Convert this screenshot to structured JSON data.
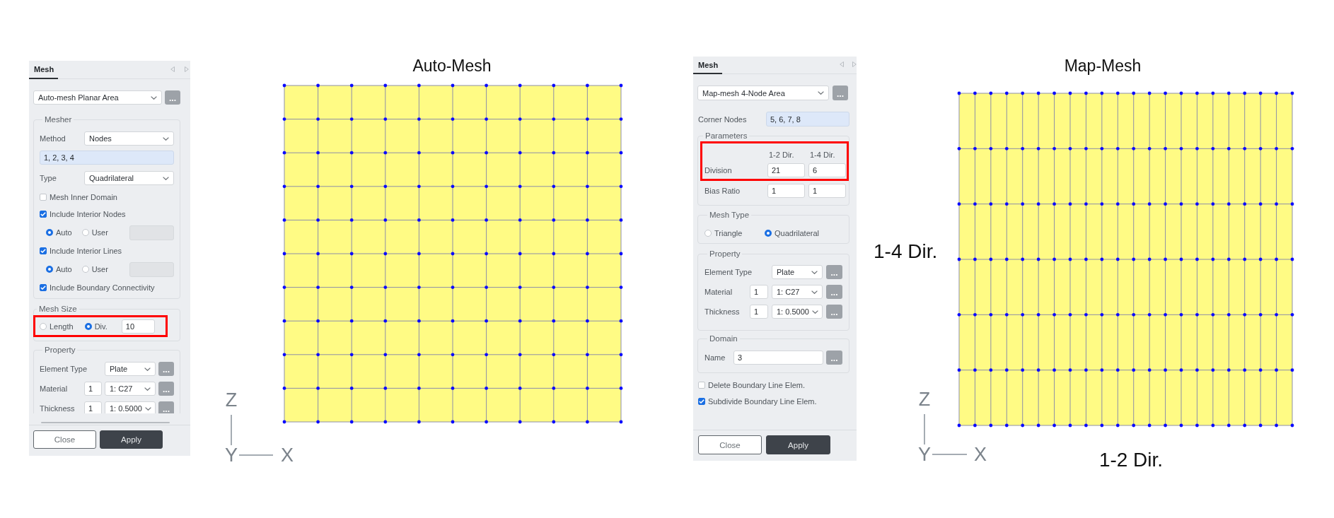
{
  "auto_mesh": {
    "panel": {
      "tabs": [
        {
          "label": "Mesh",
          "selected": true
        }
      ],
      "mesh_mode": {
        "value": "Auto-mesh Planar Area",
        "button": "..."
      },
      "mesher": {
        "legend": "Mesher",
        "method": {
          "label": "Method",
          "value": "Nodes"
        },
        "nodes": {
          "value": "1, 2, 3, 4"
        },
        "type": {
          "label": "Type",
          "value": "Quadrilateral"
        },
        "options": [
          {
            "kind": "checkbox",
            "label": "Mesh Inner Domain",
            "checked": false
          },
          {
            "kind": "checkbox",
            "label": "Include Interior Nodes",
            "checked": true
          },
          {
            "kind": "choice",
            "options": [
              {
                "label": "Auto",
                "selected": true
              },
              {
                "label": "User",
                "selected": false
              }
            ],
            "field": {
              "disabled": true
            }
          },
          {
            "kind": "checkbox",
            "label": "Include Interior Lines",
            "checked": true
          },
          {
            "kind": "choice",
            "options": [
              {
                "label": "Auto",
                "selected": true
              },
              {
                "label": "User",
                "selected": false
              }
            ],
            "field": {
              "disabled": true
            }
          },
          {
            "kind": "checkbox",
            "label": "Include Boundary Connectivity",
            "checked": true
          }
        ]
      },
      "mesh_size": {
        "legend": "Mesh Size",
        "highlighted": true,
        "choices": [
          {
            "label": "Length",
            "selected": false
          },
          {
            "label": "Div.",
            "selected": true
          }
        ],
        "value": "10"
      },
      "property": {
        "legend": "Property",
        "rows": [
          {
            "kind": "select",
            "label": "Element Type",
            "value": "Plate",
            "button": "..."
          },
          {
            "kind": "indexed",
            "label": "Material",
            "number": "1",
            "value": "1: C27",
            "button": "..."
          },
          {
            "kind": "indexed",
            "label": "Thickness",
            "number": "1",
            "value": "1: 0.5000",
            "button": "..."
          }
        ]
      },
      "buttons": [
        {
          "label": "Close",
          "kind": "secondary"
        },
        {
          "label": "Apply",
          "kind": "primary"
        }
      ]
    },
    "viewport": {
      "title": "Auto-Mesh",
      "axes": {
        "vertical": "Z",
        "horizontal": "X",
        "depth": "Y"
      }
    }
  },
  "map_mesh": {
    "panel": {
      "tabs": [
        {
          "label": "Mesh",
          "selected": true
        }
      ],
      "mesh_mode": {
        "value": "Map-mesh 4-Node Area",
        "button": "..."
      },
      "corner_nodes": {
        "label": "Corner Nodes",
        "value": "5, 6, 7, 8"
      },
      "parameters": {
        "legend": "Parameters",
        "highlighted": true,
        "columns": [
          "1-2 Dir.",
          "1-4 Dir."
        ],
        "rows": [
          {
            "label": "Division",
            "values": [
              "21",
              "6"
            ]
          },
          {
            "label": "Bias Ratio",
            "values": [
              "1",
              "1"
            ]
          }
        ]
      },
      "mesh_type": {
        "legend": "Mesh Type",
        "choices": [
          {
            "label": "Triangle",
            "selected": false
          },
          {
            "label": "Quadrilateral",
            "selected": true
          }
        ]
      },
      "property": {
        "legend": "Property",
        "rows": [
          {
            "kind": "select",
            "label": "Element Type",
            "value": "Plate",
            "button": "..."
          },
          {
            "kind": "indexed",
            "label": "Material",
            "number": "1",
            "value": "1: C27",
            "button": "..."
          },
          {
            "kind": "indexed",
            "label": "Thickness",
            "number": "1",
            "value": "1: 0.5000",
            "button": "..."
          }
        ]
      },
      "domain": {
        "legend": "Domain",
        "label": "Name",
        "value": "3",
        "button": "..."
      },
      "options": [
        {
          "label": "Delete Boundary Line Elem.",
          "checked": false
        },
        {
          "label": "Subdivide Boundary Line Elem.",
          "checked": true
        }
      ],
      "buttons": [
        {
          "label": "Close",
          "kind": "secondary"
        },
        {
          "label": "Apply",
          "kind": "primary"
        }
      ]
    },
    "viewport": {
      "title": "Map-Mesh",
      "axes": {
        "vertical": "Z",
        "horizontal": "X",
        "depth": "Y"
      },
      "direction_labels": {
        "vertical": "1-4 Dir.",
        "horizontal": "1-2 Dir."
      }
    }
  }
}
